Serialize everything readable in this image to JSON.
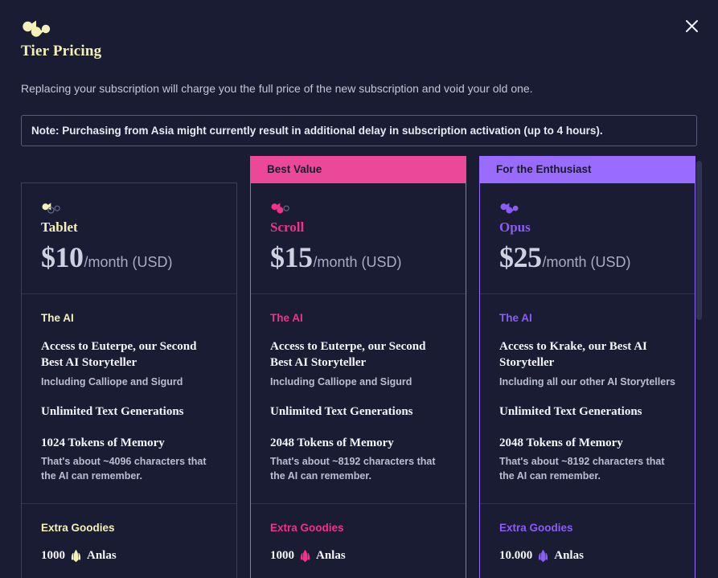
{
  "window": {
    "background_color": "#191c32",
    "close_label": "close-icon"
  },
  "header": {
    "logo_icon": "novelai-logo-icon",
    "title": "Tier Pricing"
  },
  "intro": {
    "description": "Replacing your subscription will charge you the full price of the new subscription and void your old one.",
    "note": "Note: Purchasing from Asia might currently result in additional delay in subscription activation (up to 4 hours)."
  },
  "colors": {
    "tablet_accent": "#f3f0b9",
    "scroll_accent": "#f0328c",
    "scroll_banner": "#ec4899",
    "opus_accent": "#8b5cf6",
    "opus_banner": "#9a6bff",
    "card_border": "#3a3f5c",
    "divider": "#2e3350"
  },
  "tiers": [
    {
      "banner": "",
      "icon": "tier-icon-tablet",
      "name": "Tablet",
      "price": "$10",
      "period": "/month (USD)",
      "sections": [
        {
          "heading": "The AI",
          "features": [
            {
              "title": "Access to Euterpe, our Second Best AI Storyteller",
              "sub": "Including Calliope and Sigurd"
            },
            {
              "title": "Unlimited Text Generations",
              "sub": ""
            },
            {
              "title": "1024 Tokens of Memory",
              "sub": "That's about ~4096 characters that the AI can remember."
            }
          ]
        },
        {
          "heading": "Extra Goodies",
          "anlas_amount": "1000",
          "anlas_label": "Anlas",
          "anlas_icon": "anlas-crystal-icon"
        }
      ]
    },
    {
      "banner": "Best Value",
      "icon": "tier-icon-scroll",
      "name": "Scroll",
      "price": "$15",
      "period": "/month (USD)",
      "sections": [
        {
          "heading": "The AI",
          "features": [
            {
              "title": "Access to Euterpe, our Second Best AI Storyteller",
              "sub": "Including Calliope and Sigurd"
            },
            {
              "title": "Unlimited Text Generations",
              "sub": ""
            },
            {
              "title": "2048 Tokens of Memory",
              "sub": "That's about ~8192 characters that the AI can remember."
            }
          ]
        },
        {
          "heading": "Extra Goodies",
          "anlas_amount": "1000",
          "anlas_label": "Anlas",
          "anlas_icon": "anlas-crystal-icon"
        }
      ]
    },
    {
      "banner": "For the Enthusiast",
      "icon": "tier-icon-opus",
      "name": "Opus",
      "price": "$25",
      "period": "/month (USD)",
      "sections": [
        {
          "heading": "The AI",
          "features": [
            {
              "title": "Access to Krake, our Best AI Storyteller",
              "sub": "Including all our other AI Storytellers"
            },
            {
              "title": "Unlimited Text Generations",
              "sub": ""
            },
            {
              "title": "2048 Tokens of Memory",
              "sub": "That's about ~8192 characters that the AI can remember."
            }
          ]
        },
        {
          "heading": "Extra Goodies",
          "anlas_amount": "10.000",
          "anlas_label": "Anlas",
          "anlas_icon": "anlas-crystal-icon"
        }
      ]
    }
  ]
}
